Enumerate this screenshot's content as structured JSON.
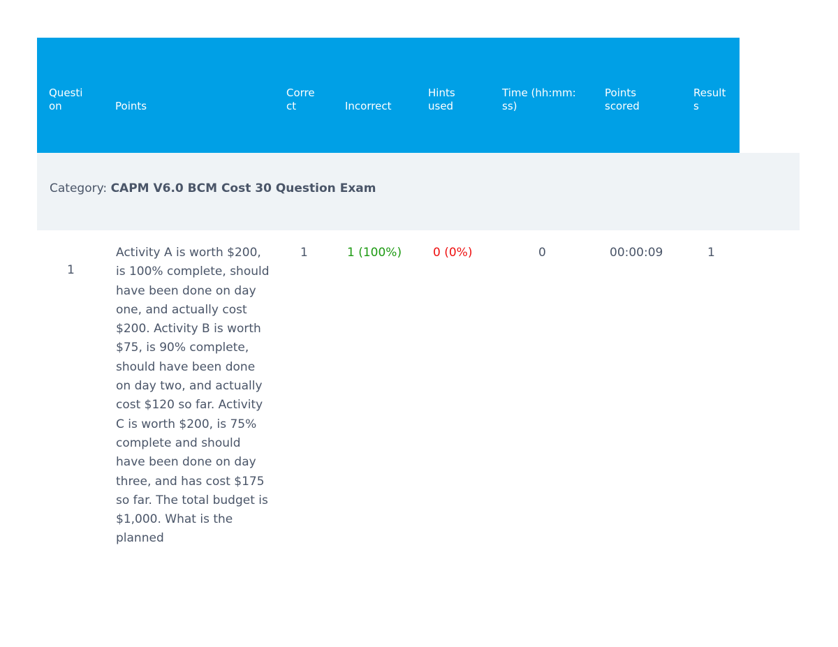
{
  "table": {
    "headers": [
      "Questi\non",
      "Points",
      "Corre\nct",
      "Incorrect",
      "Hints\nused",
      "Time (hh:mm:\nss)",
      "Points\nscored",
      "Result\ns"
    ],
    "category_label": "Category:",
    "category_name": "CAPM V6.0 BCM Cost 30 Question Exam",
    "rows": [
      {
        "question_number": "1",
        "question_text": "Activity A is worth $200, is 100% complete, should have been done on day one, and actually cost $200. Activity B is worth $75, is 90% complete, should have been done on day two, and actually cost $120 so far. Activity C is worth $200, is 75% complete and should have been done on day three, and has cost $175 so far. The total budget is $1,000. What is the planned",
        "points": "1",
        "correct": "1 (100%)",
        "incorrect": "0 (0%)",
        "hints_used": "0",
        "time": "00:00:09",
        "points_scored": "1"
      }
    ]
  },
  "colors": {
    "header_bg": "#00a0e6",
    "category_bg": "#eff3f6",
    "correct": "#1d9a12",
    "incorrect": "#ee1111",
    "text": "#4a5568"
  }
}
